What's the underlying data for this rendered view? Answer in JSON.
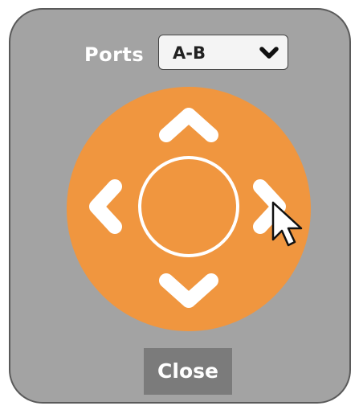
{
  "ports": {
    "label": "Ports",
    "selected": "A-B",
    "dropdown_icon": "chevron-down-icon"
  },
  "dpad": {
    "center": "circle-button",
    "up_icon": "chevron-up-icon",
    "down_icon": "chevron-down-icon",
    "left_icon": "chevron-left-icon",
    "right_icon": "chevron-right-icon"
  },
  "close_button": {
    "label": "Close"
  },
  "colors": {
    "panel_background": "#a3a3a3",
    "panel_border": "#5a5a5a",
    "dpad": "#f0963f",
    "dpad_foreground": "#ffffff",
    "close_button": "#7b7b7b"
  }
}
